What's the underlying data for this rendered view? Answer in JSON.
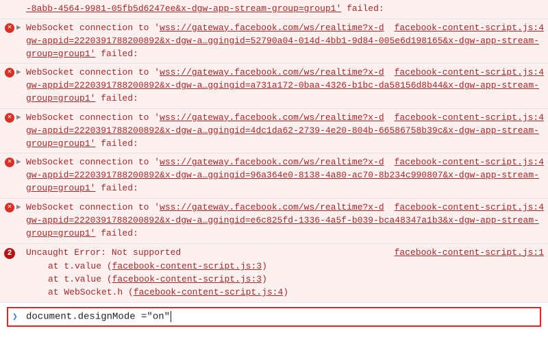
{
  "errors": [
    {
      "prefix": "",
      "url_part": "-8abb-4564-9981-05fb5d6247ee&x-dgw-app-stream-group=group1'",
      "tail": " failed:",
      "src": ""
    },
    {
      "prefix": "WebSocket connection to '",
      "url_part": "wss://gateway.facebook.com/ws/realtime?x-dgw-appid=2220391788200892&x-dgw-a…ggingid=52790a04-014d-4bb1-9d84-005e6d198165&x-dgw-app-stream-group=group1'",
      "tail": " failed:",
      "src": "facebook-content-script.js:4"
    },
    {
      "prefix": "WebSocket connection to '",
      "url_part": "wss://gateway.facebook.com/ws/realtime?x-dgw-appid=2220391788200892&x-dgw-a…ggingid=a731a172-0baa-4326-b1bc-da58156d8b44&x-dgw-app-stream-group=group1'",
      "tail": " failed:",
      "src": "facebook-content-script.js:4"
    },
    {
      "prefix": "WebSocket connection to '",
      "url_part": "wss://gateway.facebook.com/ws/realtime?x-dgw-appid=2220391788200892&x-dgw-a…ggingid=4dc1da62-2739-4e20-804b-66586758b39c&x-dgw-app-stream-group=group1'",
      "tail": " failed:",
      "src": "facebook-content-script.js:4"
    },
    {
      "prefix": "WebSocket connection to '",
      "url_part": "wss://gateway.facebook.com/ws/realtime?x-dgw-appid=2220391788200892&x-dgw-a…ggingid=96a364e0-8138-4a80-ac70-8b234c990807&x-dgw-app-stream-group=group1'",
      "tail": " failed:",
      "src": "facebook-content-script.js:4"
    },
    {
      "prefix": "WebSocket connection to '",
      "url_part": "wss://gateway.facebook.com/ws/realtime?x-dgw-appid=2220391788200892&x-dgw-a…ggingid=e6c825fd-1336-4a5f-b039-bca48347a1b3&x-dgw-app-stream-group=group1'",
      "tail": " failed:",
      "src": "facebook-content-script.js:4"
    }
  ],
  "uncaught": {
    "count": "2",
    "title": "Uncaught Error: Not supported",
    "src": "facebook-content-script.js:1",
    "stack": [
      {
        "at": "at t.value (",
        "src": "facebook-content-script.js:3",
        "close": ")"
      },
      {
        "at": "at t.value (",
        "src": "facebook-content-script.js:3",
        "close": ")"
      },
      {
        "at": "at WebSocket.h (",
        "src": "facebook-content-script.js:4",
        "close": ")"
      }
    ]
  },
  "prompt": {
    "chevron": "❯",
    "value": "document.designMode =\"on\""
  },
  "glyphs": {
    "x": "✕",
    "tri": "▶"
  }
}
